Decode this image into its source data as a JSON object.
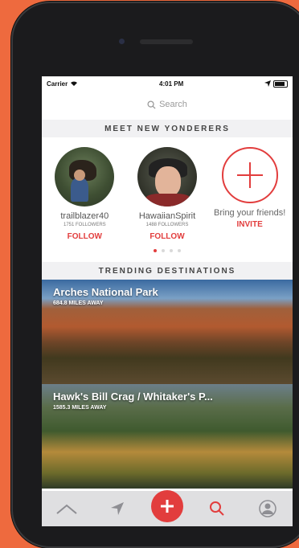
{
  "status_bar": {
    "carrier": "Carrier",
    "time": "4:01 PM"
  },
  "search": {
    "placeholder": "Search"
  },
  "meet_section": {
    "title": "MEET NEW YONDERERS",
    "people": [
      {
        "username": "trailblazer40",
        "followers": "1751 FOLLOWERS",
        "action": "FOLLOW"
      },
      {
        "username": "HawaiianSpirit",
        "followers": "1488 FOLLOWERS",
        "action": "FOLLOW"
      }
    ],
    "invite": {
      "text": "Bring your friends!",
      "action": "INVITE"
    },
    "pagination": {
      "total": 4,
      "active_index": 0
    }
  },
  "trending_section": {
    "title": "TRENDING DESTINATIONS",
    "destinations": [
      {
        "name": "Arches National Park",
        "distance": "684.8 MILES AWAY"
      },
      {
        "name": "Hawk's Bill Crag / Whitaker's P...",
        "distance": "1585.3 MILES AWAY"
      }
    ]
  },
  "tab_bar": {
    "tabs": [
      "home-icon",
      "navigate-icon",
      "add-icon",
      "search-icon",
      "profile-icon"
    ],
    "accent": "#E23D3D"
  },
  "colors": {
    "accent": "#E23D3D",
    "background": "#EE6A3E"
  }
}
